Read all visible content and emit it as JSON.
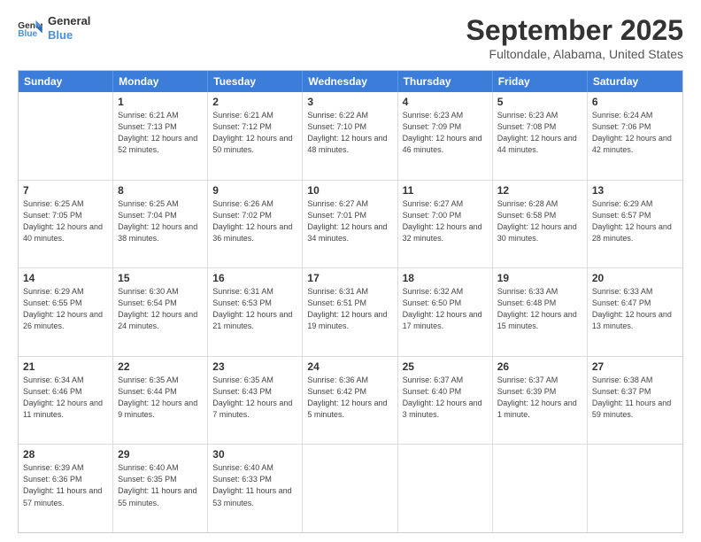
{
  "header": {
    "logo_line1": "General",
    "logo_line2": "Blue",
    "month": "September 2025",
    "location": "Fultondale, Alabama, United States"
  },
  "weekdays": [
    "Sunday",
    "Monday",
    "Tuesday",
    "Wednesday",
    "Thursday",
    "Friday",
    "Saturday"
  ],
  "rows": [
    [
      {
        "day": "",
        "sunrise": "",
        "sunset": "",
        "daylight": ""
      },
      {
        "day": "1",
        "sunrise": "6:21 AM",
        "sunset": "7:13 PM",
        "daylight": "12 hours and 52 minutes."
      },
      {
        "day": "2",
        "sunrise": "6:21 AM",
        "sunset": "7:12 PM",
        "daylight": "12 hours and 50 minutes."
      },
      {
        "day": "3",
        "sunrise": "6:22 AM",
        "sunset": "7:10 PM",
        "daylight": "12 hours and 48 minutes."
      },
      {
        "day": "4",
        "sunrise": "6:23 AM",
        "sunset": "7:09 PM",
        "daylight": "12 hours and 46 minutes."
      },
      {
        "day": "5",
        "sunrise": "6:23 AM",
        "sunset": "7:08 PM",
        "daylight": "12 hours and 44 minutes."
      },
      {
        "day": "6",
        "sunrise": "6:24 AM",
        "sunset": "7:06 PM",
        "daylight": "12 hours and 42 minutes."
      }
    ],
    [
      {
        "day": "7",
        "sunrise": "6:25 AM",
        "sunset": "7:05 PM",
        "daylight": "12 hours and 40 minutes."
      },
      {
        "day": "8",
        "sunrise": "6:25 AM",
        "sunset": "7:04 PM",
        "daylight": "12 hours and 38 minutes."
      },
      {
        "day": "9",
        "sunrise": "6:26 AM",
        "sunset": "7:02 PM",
        "daylight": "12 hours and 36 minutes."
      },
      {
        "day": "10",
        "sunrise": "6:27 AM",
        "sunset": "7:01 PM",
        "daylight": "12 hours and 34 minutes."
      },
      {
        "day": "11",
        "sunrise": "6:27 AM",
        "sunset": "7:00 PM",
        "daylight": "12 hours and 32 minutes."
      },
      {
        "day": "12",
        "sunrise": "6:28 AM",
        "sunset": "6:58 PM",
        "daylight": "12 hours and 30 minutes."
      },
      {
        "day": "13",
        "sunrise": "6:29 AM",
        "sunset": "6:57 PM",
        "daylight": "12 hours and 28 minutes."
      }
    ],
    [
      {
        "day": "14",
        "sunrise": "6:29 AM",
        "sunset": "6:55 PM",
        "daylight": "12 hours and 26 minutes."
      },
      {
        "day": "15",
        "sunrise": "6:30 AM",
        "sunset": "6:54 PM",
        "daylight": "12 hours and 24 minutes."
      },
      {
        "day": "16",
        "sunrise": "6:31 AM",
        "sunset": "6:53 PM",
        "daylight": "12 hours and 21 minutes."
      },
      {
        "day": "17",
        "sunrise": "6:31 AM",
        "sunset": "6:51 PM",
        "daylight": "12 hours and 19 minutes."
      },
      {
        "day": "18",
        "sunrise": "6:32 AM",
        "sunset": "6:50 PM",
        "daylight": "12 hours and 17 minutes."
      },
      {
        "day": "19",
        "sunrise": "6:33 AM",
        "sunset": "6:48 PM",
        "daylight": "12 hours and 15 minutes."
      },
      {
        "day": "20",
        "sunrise": "6:33 AM",
        "sunset": "6:47 PM",
        "daylight": "12 hours and 13 minutes."
      }
    ],
    [
      {
        "day": "21",
        "sunrise": "6:34 AM",
        "sunset": "6:46 PM",
        "daylight": "12 hours and 11 minutes."
      },
      {
        "day": "22",
        "sunrise": "6:35 AM",
        "sunset": "6:44 PM",
        "daylight": "12 hours and 9 minutes."
      },
      {
        "day": "23",
        "sunrise": "6:35 AM",
        "sunset": "6:43 PM",
        "daylight": "12 hours and 7 minutes."
      },
      {
        "day": "24",
        "sunrise": "6:36 AM",
        "sunset": "6:42 PM",
        "daylight": "12 hours and 5 minutes."
      },
      {
        "day": "25",
        "sunrise": "6:37 AM",
        "sunset": "6:40 PM",
        "daylight": "12 hours and 3 minutes."
      },
      {
        "day": "26",
        "sunrise": "6:37 AM",
        "sunset": "6:39 PM",
        "daylight": "12 hours and 1 minute."
      },
      {
        "day": "27",
        "sunrise": "6:38 AM",
        "sunset": "6:37 PM",
        "daylight": "11 hours and 59 minutes."
      }
    ],
    [
      {
        "day": "28",
        "sunrise": "6:39 AM",
        "sunset": "6:36 PM",
        "daylight": "11 hours and 57 minutes."
      },
      {
        "day": "29",
        "sunrise": "6:40 AM",
        "sunset": "6:35 PM",
        "daylight": "11 hours and 55 minutes."
      },
      {
        "day": "30",
        "sunrise": "6:40 AM",
        "sunset": "6:33 PM",
        "daylight": "11 hours and 53 minutes."
      },
      {
        "day": "",
        "sunrise": "",
        "sunset": "",
        "daylight": ""
      },
      {
        "day": "",
        "sunrise": "",
        "sunset": "",
        "daylight": ""
      },
      {
        "day": "",
        "sunrise": "",
        "sunset": "",
        "daylight": ""
      },
      {
        "day": "",
        "sunrise": "",
        "sunset": "",
        "daylight": ""
      }
    ]
  ]
}
